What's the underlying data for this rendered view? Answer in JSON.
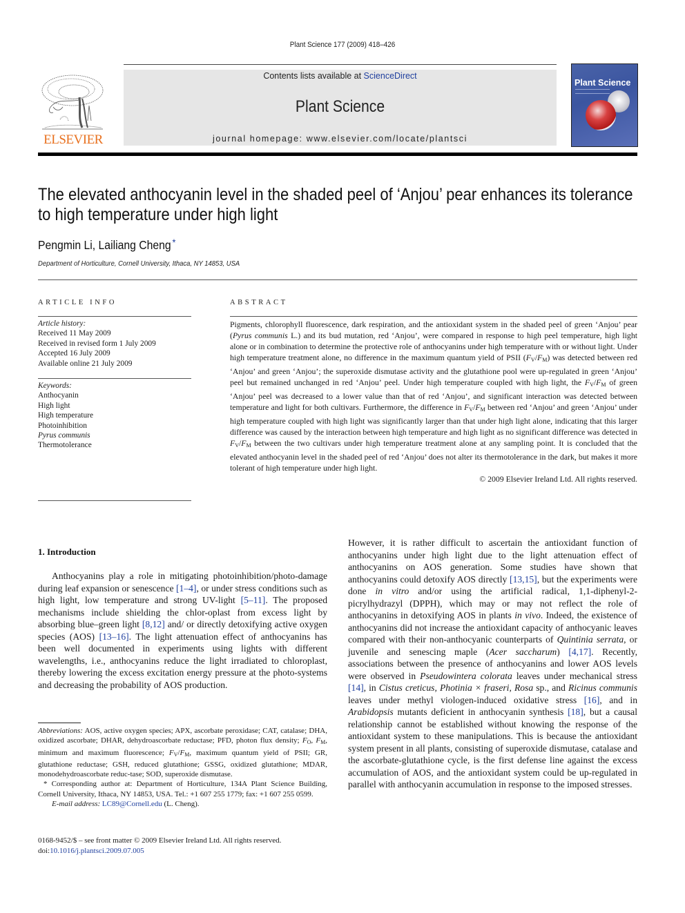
{
  "header": {
    "running_head": "Plant Science 177 (2009) 418–426",
    "contents_prefix": "Contents lists available at ",
    "contents_link": "ScienceDirect",
    "journal_name": "Plant Science",
    "homepage": "journal homepage: www.elsevier.com/locate/plantsci",
    "publisher_wordmark": "ELSEVIER",
    "cover_title": "Plant Science",
    "link_color": "#1f3f9e",
    "publisher_color": "#e8701e"
  },
  "article": {
    "title": "The elevated anthocyanin level in the shaded peel of ‘Anjou’ pear enhances its tolerance to high temperature under high light",
    "authors": "Pengmin Li, Lailiang Cheng",
    "corresponding_marker": "*",
    "affiliation": "Department of Horticulture, Cornell University, Ithaca, NY 14853, USA"
  },
  "article_info": {
    "heading": "ARTICLE INFO",
    "history_label": "Article history:",
    "history": [
      "Received 11 May 2009",
      "Received in revised form 1 July 2009",
      "Accepted 16 July 2009",
      "Available online 21 July 2009"
    ],
    "keywords_label": "Keywords:",
    "keywords": [
      "Anthocyanin",
      "High light",
      "High temperature",
      "Photoinhibition",
      "Pyrus communis",
      "Thermotolerance"
    ]
  },
  "abstract": {
    "heading": "ABSTRACT",
    "p1": "Pigments, chlorophyll fluorescence, dark respiration, and the antioxidant system in the shaded peel of green ‘Anjou’ pear (",
    "p1_it": "Pyrus communis",
    "p2": " L.) and its bud mutation, red ‘Anjou’, were compared in response to high peel temperature, high light alone or in combination to determine the protective role of anthocyanins under high temperature with or without light. Under high temperature treatment alone, no difference in the maximum quantum yield of PSII (",
    "p3": ") was detected between red ‘Anjou’ and green ‘Anjou’; the superoxide dismutase activity and the glutathione pool were up-regulated in green ‘Anjou’ peel but remained unchanged in red ‘Anjou’ peel. Under high temperature coupled with high light, the ",
    "p4": " of green ‘Anjou’ peel was decreased to a lower value than that of red ‘Anjou’, and significant interaction was detected between temperature and light for both cultivars. Furthermore, the difference in ",
    "p5": " between red ‘Anjou’ and green ‘Anjou’ under high temperature coupled with high light was significantly larger than that under high light alone, indicating that this larger difference was caused by the interaction between high temperature and high light as no significant difference was detected in ",
    "p6": " between the two cultivars under high temperature treatment alone at any sampling point. It is concluded that the elevated anthocyanin level in the shaded peel of red ‘Anjou’ does not alter its thermotolerance in the dark, but makes it more tolerant of high temperature under high light.",
    "copyright": "© 2009 Elsevier Ireland Ltd. All rights reserved."
  },
  "intro": {
    "heading": "1.  Introduction",
    "c1": {
      "a": "Anthocyanins play a role in mitigating photoinhibition/photo-damage during leaf expansion or senescence ",
      "r1": "[1–4]",
      "b": ", or under stress conditions such as high light, low temperature and strong UV-light ",
      "r2": "[5–11]",
      "c": ". The proposed mechanisms include shielding the chlor-oplast from excess light by absorbing blue–green light ",
      "r3": "[8,12]",
      "d": " and/ or directly detoxifying active oxygen species (AOS) ",
      "r4": "[13–16]",
      "e": ". The light attenuation effect of anthocyanins has been well documented in experiments using lights with different wavelengths, i.e., anthocyanins reduce the light irradiated to chloroplast, thereby lowering the excess excitation energy pressure at the photo-systems and decreasing the probability of AOS production."
    },
    "c2": {
      "a": "However, it is rather difficult to ascertain the antioxidant function of anthocyanins under high light due to the light attenuation effect of anthocyanins on AOS generation. Some studies have shown that anthocyanins could detoxify AOS directly ",
      "r1": "[13,15]",
      "b": ", but the experiments were done ",
      "i1": "in vitro",
      "c": " and/or using the artificial radical, 1,1-diphenyl-2-picrylhydrazyl (DPPH), which may or may not reflect the role of anthocyanins in detoxifying AOS in plants ",
      "i2": "in vivo",
      "d": ". Indeed, the existence of anthocyanins did not increase the antioxidant capacity of anthocyanic leaves compared with their non-anthocyanic counterparts of ",
      "i3": "Quintinia serrata",
      "e": ", or juvenile and senescing maple (",
      "i4": "Acer saccharum",
      "f": ") ",
      "r2": "[4,17]",
      "g": ". Recently, associations between the presence of anthocyanins and lower AOS levels were observed in ",
      "i5": "Pseudowintera colorata",
      "h": " leaves under mechanical stress ",
      "r3": "[14]",
      "j": ", in ",
      "i6": "Cistus creticus, Photinia × fraseri, Rosa",
      "k": " sp., and ",
      "i7": "Ricinus communis",
      "l": " leaves under methyl viologen-induced oxidative stress ",
      "r4": "[16]",
      "m": ", and in ",
      "i8": "Arabidopsis",
      "n": " mutants deficient in anthocyanin synthesis ",
      "r5": "[18]",
      "o": ", but a causal relationship cannot be established without knowing the response of the antioxidant system to these manipulations. This is because the antioxidant system present in all plants, consisting of superoxide dismutase, catalase and the ascorbate-glutathione cycle, is the first defense line against the excess accumulation of AOS, and the antioxidant system could be up-regulated in parallel with anthocyanin accumulation in response to the imposed stresses."
    }
  },
  "footnotes": {
    "abbr_label": "Abbreviations:",
    "abbr_a": " AOS, active oxygen species; APX, ascorbate peroxidase; CAT, catalase; DHA, oxidized ascorbate; DHAR, dehydroascorbate reductase; PFD, photon flux density; ",
    "abbr_b": ", minimum and maximum fluorescence; ",
    "abbr_c": ", maximum quantum yield of PSII; GR, glutathione reductase; GSH, reduced glutathione; GSSG, oxidized glutathione; MDAR, monodehydroascorbate reduc-tase; SOD, superoxide dismutase.",
    "corresponding": "* Corresponding author at: Department of Horticulture, 134A Plant Science Building, Cornell University, Ithaca, NY 14853, USA. Tel.: +1 607 255 1779; fax: +1 607 255 0599.",
    "email_label": "E-mail address:",
    "email": "LC89@Cornell.edu",
    "email_suffix": " (L. Cheng).",
    "issn_line": "0168-9452/$ – see front matter © 2009 Elsevier Ireland Ltd. All rights reserved.",
    "doi_prefix": "doi:",
    "doi": "10.1016/j.plantsci.2009.07.005"
  },
  "symbols": {
    "F": "F",
    "V": "V",
    "M": "M",
    "O": "O",
    "slash": "/",
    "comma": ", "
  }
}
